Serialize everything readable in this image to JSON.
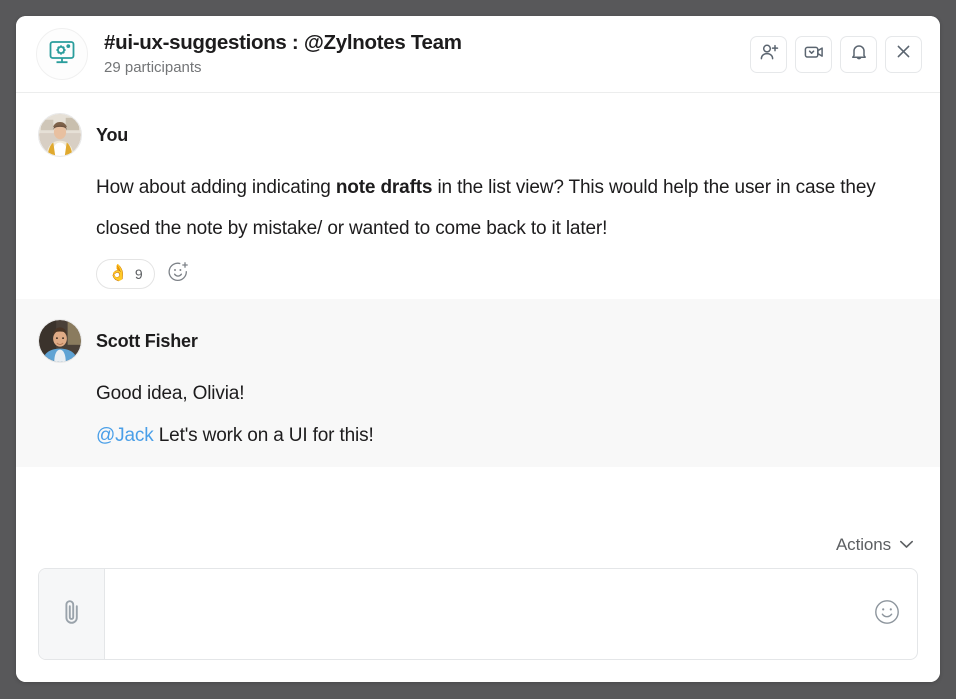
{
  "window": {
    "background_color": "#58585a",
    "card_background": "#ffffff"
  },
  "header": {
    "channel_icon": "monitor-gear-icon",
    "channel_icon_color": "#2a9d9c",
    "title": "#ui-ux-suggestions : @Zylnotes Team",
    "participants": "29 participants",
    "actions": [
      {
        "name": "add-person-icon",
        "label": "Add people"
      },
      {
        "name": "video-call-icon",
        "label": "Start video call"
      },
      {
        "name": "bell-icon",
        "label": "Notifications"
      },
      {
        "name": "close-icon",
        "label": "Close"
      }
    ]
  },
  "messages": [
    {
      "author": "You",
      "avatar": "avatar-olivia",
      "background": "#ffffff",
      "text_before_bold": "How about adding indicating ",
      "bold_text": "note drafts",
      "text_after_bold": " in the list view?   This would help the user in case they closed the note by mistake/ or wanted to come back to it later!",
      "reactions": [
        {
          "emoji": "👌",
          "emoji_name": "ok-hand-emoji",
          "count": "9"
        }
      ],
      "add_reaction_icon": "add-reaction-icon"
    },
    {
      "author": "Scott Fisher",
      "avatar": "avatar-scott",
      "background": "#f8f8f8",
      "line1": "Good idea, Olivia!",
      "mention": "@Jack",
      "mention_color": "#4a9fe8",
      "line2_rest": " Let's work on a UI for this!"
    }
  ],
  "composer": {
    "actions_label": "Actions",
    "actions_chevron": "chevron-down-icon",
    "attach_icon": "paperclip-icon",
    "input_value": "",
    "input_placeholder": "",
    "emoji_icon": "smiley-icon"
  }
}
